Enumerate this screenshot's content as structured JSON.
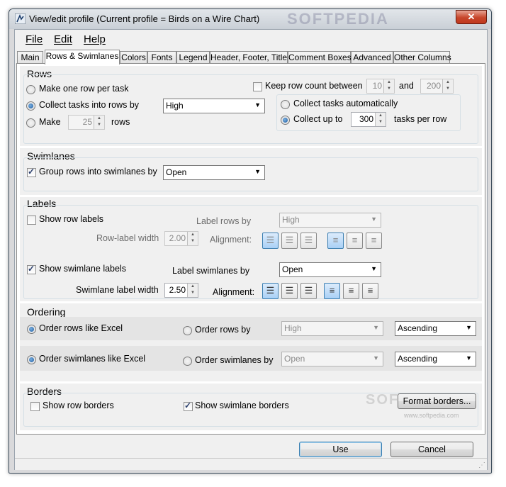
{
  "window": {
    "title": "View/edit profile (Current profile = Birds on a Wire Chart)",
    "close_label": "✕"
  },
  "menu": [
    "File",
    "Edit",
    "Help"
  ],
  "tabs": [
    "Main",
    "Rows & Swimlanes",
    "Colors",
    "Fonts",
    "Legend",
    "Header, Footer, Title",
    "Comment Boxes",
    "Advanced",
    "Other Columns"
  ],
  "rows": {
    "title": "Rows",
    "opt_one_per_task": "Make one row per task",
    "opt_collect_by": "Collect tasks into rows by",
    "collect_by_value": "High",
    "opt_make": "Make",
    "make_count": "25",
    "make_suffix": "rows",
    "keep_count_label": "Keep row count between",
    "keep_min": "10",
    "and_label": "and",
    "keep_max": "200",
    "collect_auto": "Collect tasks automatically",
    "collect_up_to": "Collect up to",
    "up_to_value": "300",
    "tasks_per_row": "tasks per row"
  },
  "swimlanes": {
    "title": "Swimlanes",
    "group_label": "Group rows into swimlanes by",
    "group_value": "Open"
  },
  "labels": {
    "title": "Labels",
    "show_row_labels": "Show row labels",
    "label_rows_by": "Label rows by",
    "label_rows_value": "High",
    "row_label_width": "Row-label width",
    "row_width_value": "2.00",
    "alignment": "Alignment:",
    "show_swim_labels": "Show swimlane labels",
    "label_swim_by": "Label swimlanes by",
    "label_swim_value": "Open",
    "swim_label_width": "Swimlane label width",
    "swim_width_value": "2.50"
  },
  "ordering": {
    "title": "Ordering",
    "rows_like_excel": "Order rows like Excel",
    "order_rows_by": "Order rows by",
    "rows_by_value": "High",
    "rows_dir": "Ascending",
    "swim_like_excel": "Order swimlanes like Excel",
    "order_swim_by": "Order swimlanes by",
    "swim_by_value": "Open",
    "swim_dir": "Ascending"
  },
  "borders": {
    "title": "Borders",
    "show_row_borders": "Show row borders",
    "show_swim_borders": "Show swimlane borders",
    "format_button": "Format borders..."
  },
  "buttons": {
    "use": "Use",
    "cancel": "Cancel"
  },
  "watermark": {
    "title_mark": "SOFTPEDIA",
    "body_mark": "SOFTPEDIA",
    "body_url": "www.softpedia.com"
  }
}
